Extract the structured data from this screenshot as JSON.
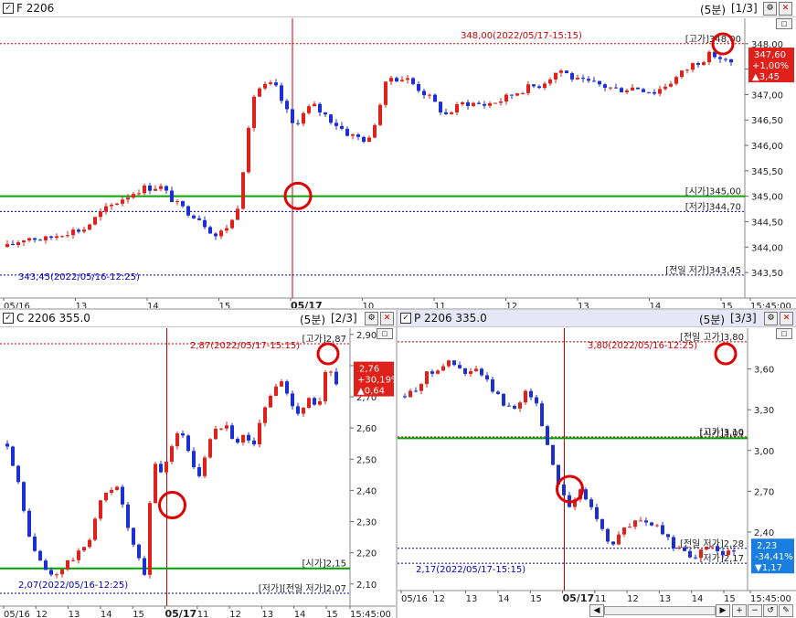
{
  "panes": [
    {
      "title": "F 2206",
      "period": "(5분)",
      "page": "[1/3]",
      "ylim": [
        343.25,
        348.5
      ],
      "ticks": [
        {
          "v": 348.0,
          "t": "348,00"
        },
        {
          "v": 347.5,
          "t": "347,50"
        },
        {
          "v": 347.0,
          "t": "347,00"
        },
        {
          "v": 346.5,
          "t": "346,50"
        },
        {
          "v": 346.0,
          "t": "346,00"
        },
        {
          "v": 345.5,
          "t": "345,50"
        },
        {
          "v": 345.0,
          "t": "345,00"
        },
        {
          "v": 344.5,
          "t": "344,50"
        },
        {
          "v": 344.0,
          "t": "344,00"
        },
        {
          "v": 343.5,
          "t": "343,50"
        }
      ],
      "xlabels": [
        "05/16",
        "13",
        "14",
        "15",
        "05/17",
        "10",
        "11",
        "12",
        "13",
        "14",
        "15",
        "15:45:00"
      ],
      "refs": [
        {
          "v": 348.0,
          "type": "high",
          "text": "[고가]348,00"
        },
        {
          "v": 345.0,
          "type": "open",
          "text": "[시가]345,00"
        },
        {
          "v": 344.7,
          "type": "low",
          "text": "[저가]344,70"
        },
        {
          "v": 343.45,
          "type": "prevlow",
          "text": "[전일 저가]343,45"
        }
      ],
      "notes": [
        {
          "text": "348,00(2022/05/17-15:15)",
          "color": "#d00000"
        },
        {
          "text": "343,45(2022/05/16-12:25)",
          "color": "#0000c0"
        }
      ],
      "current": {
        "price": "347,60",
        "pct": "+1,00%",
        "change": "▲3,45",
        "v": 347.6,
        "dir": "up"
      },
      "anchors": [
        344.0,
        344.2,
        344.15,
        344.3,
        344.35,
        344.7,
        344.95,
        345.15,
        345.2,
        344.8,
        344.6,
        344.2,
        344.6,
        347.1,
        347.2,
        346.4,
        346.8,
        346.5,
        346.2,
        346.1,
        347.35,
        347.3,
        347.0,
        346.6,
        346.85,
        346.8,
        346.9,
        347.1,
        347.2,
        347.5,
        347.25,
        347.2,
        347.1,
        347.15,
        347.05,
        347.3,
        347.6,
        347.8,
        347.6
      ]
    },
    {
      "title": "C 2206 355.0",
      "period": "(5분)",
      "page": "[2/3]",
      "ylim": [
        2.07,
        2.92
      ],
      "ticks": [
        {
          "v": 2.9,
          "t": "2,90"
        },
        {
          "v": 2.8,
          "t": "2,80"
        },
        {
          "v": 2.7,
          "t": "2,70"
        },
        {
          "v": 2.6,
          "t": "2,60"
        },
        {
          "v": 2.5,
          "t": "2,50"
        },
        {
          "v": 2.4,
          "t": "2,40"
        },
        {
          "v": 2.3,
          "t": "2,30"
        },
        {
          "v": 2.2,
          "t": "2,20"
        },
        {
          "v": 2.1,
          "t": "2,10"
        }
      ],
      "xlabels": [
        "05/16",
        "12",
        "13",
        "14",
        "15",
        "05/17",
        "11",
        "12",
        "13",
        "14",
        "15",
        "15:45:00"
      ],
      "refs": [
        {
          "v": 2.87,
          "type": "high",
          "text": "[고가]2,87"
        },
        {
          "v": 2.15,
          "type": "open",
          "text": "[시가]2,15"
        },
        {
          "v": 2.07,
          "type": "low",
          "text": "[저가][전일 저가]2,07"
        }
      ],
      "notes": [
        {
          "text": "2,87(2022/05/17-15:15)",
          "color": "#d00000"
        },
        {
          "text": "2,07(2022/05/16-12:25)",
          "color": "#0000c0"
        }
      ],
      "current": {
        "price": "2,76",
        "pct": "+30,19%",
        "change": "▲0,64",
        "v": 2.76,
        "dir": "up"
      },
      "anchors": [
        2.55,
        2.45,
        2.3,
        2.2,
        2.15,
        2.12,
        2.15,
        2.18,
        2.2,
        2.25,
        2.35,
        2.4,
        2.42,
        2.3,
        2.2,
        2.13,
        2.5,
        2.45,
        2.55,
        2.6,
        2.5,
        2.45,
        2.55,
        2.6,
        2.62,
        2.55,
        2.58,
        2.55,
        2.65,
        2.72,
        2.75,
        2.68,
        2.65,
        2.7,
        2.65,
        2.8,
        2.75
      ]
    },
    {
      "title": "P 2206 335.0",
      "period": "(5분)",
      "page": "[3/3]",
      "ylim": [
        2.07,
        3.9
      ],
      "ticks": [
        {
          "v": 3.6,
          "t": "3,60"
        },
        {
          "v": 3.3,
          "t": "3,30"
        },
        {
          "v": 3.0,
          "t": "3,00"
        },
        {
          "v": 2.7,
          "t": "2,70"
        },
        {
          "v": 2.4,
          "t": "2,40"
        }
      ],
      "xlabels": [
        "05/16",
        "12",
        "13",
        "14",
        "15",
        "05/17",
        "11",
        "12",
        "13",
        "14",
        "15",
        "15:45:00"
      ],
      "refs": [
        {
          "v": 3.8,
          "type": "prevhigh",
          "text": "[전일 고가]3,80"
        },
        {
          "v": 3.1,
          "type": "high",
          "text": "[고가]3,10"
        },
        {
          "v": 3.09,
          "type": "open",
          "text": "[시가]3,09"
        },
        {
          "v": 2.28,
          "type": "prevlow",
          "text": "[전일 저가]2,28"
        },
        {
          "v": 2.17,
          "type": "low",
          "text": "[저가]2,17"
        }
      ],
      "notes": [
        {
          "text": "3,80(2022/05/16-12:25)",
          "color": "#d00000"
        },
        {
          "text": "2,17(2022/05/17-15:15)",
          "color": "#0000c0"
        }
      ],
      "current": {
        "price": "2,23",
        "pct": "-34,41%",
        "change": "▼1,17",
        "v": 2.23,
        "dir": "down"
      },
      "anchors": [
        3.4,
        3.45,
        3.55,
        3.6,
        3.65,
        3.62,
        3.55,
        3.6,
        3.5,
        3.4,
        3.3,
        3.35,
        3.45,
        3.3,
        3.0,
        2.75,
        2.6,
        2.7,
        2.6,
        2.45,
        2.3,
        2.4,
        2.45,
        2.5,
        2.45,
        2.4,
        2.3,
        2.28,
        2.22,
        2.25,
        2.3,
        2.25,
        2.23
      ]
    }
  ],
  "colors": {
    "up": "#e0201a",
    "down": "#1c2fd6",
    "open_line": "#00a000",
    "high_line": "#d00000",
    "low_line": "#0000b0",
    "day_line": "#d00000",
    "marker": "#e00000",
    "badge_up": "#e0201a",
    "badge_down": "#1a7ee0"
  },
  "window_buttons": {
    "settings": "⚙",
    "close": "✕",
    "small": "□"
  },
  "scrollbar": {
    "left_arrow": "◀",
    "right_arrow": "▶",
    "zoom_in": "+",
    "zoom_out": "−",
    "reset": "↺",
    "tool": "✎"
  }
}
